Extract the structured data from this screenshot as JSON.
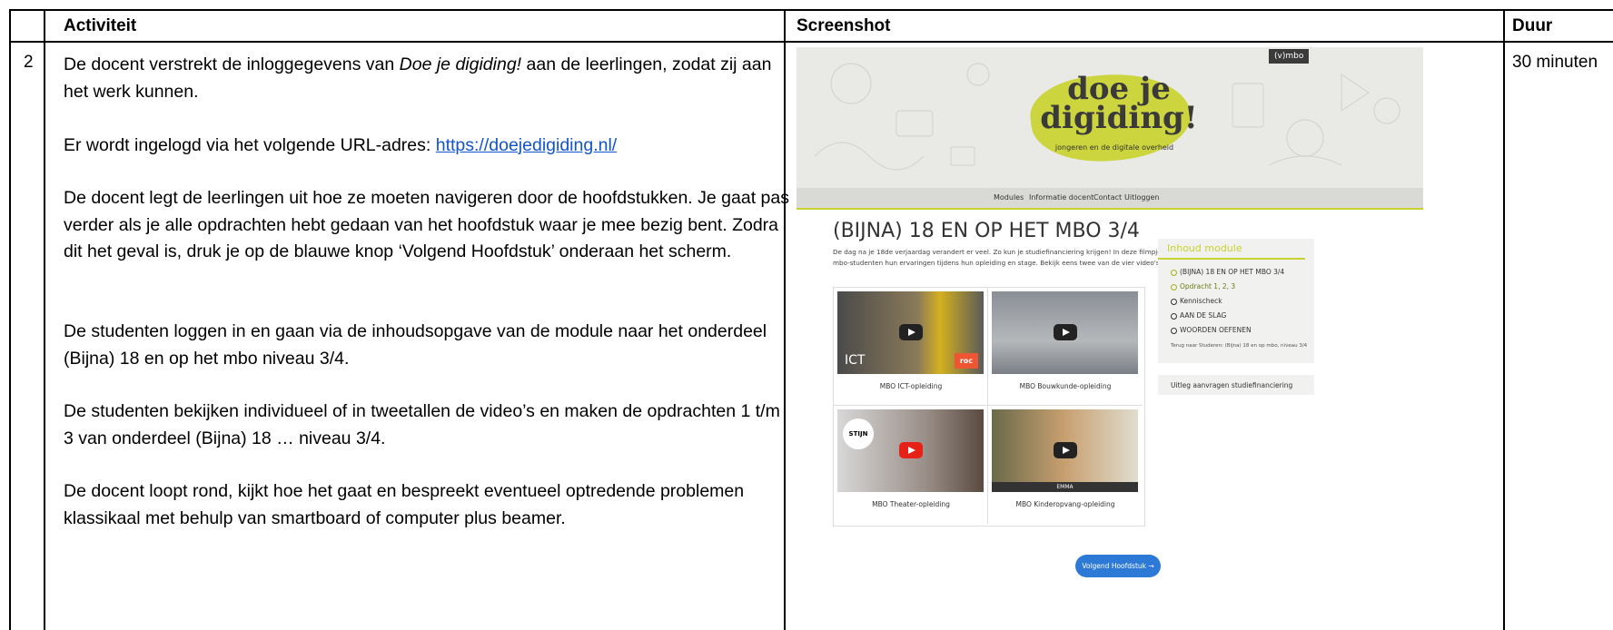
{
  "table": {
    "headers": {
      "activiteit": "Activiteit",
      "screenshot": "Screenshot",
      "duur": "Duur"
    },
    "row": {
      "number": "2",
      "duur": "30 minuten",
      "paragraphs": {
        "p1_a": "De docent verstrekt de inloggegevens van ",
        "p1_italic": "Doe je digiding!",
        "p1_b": " aan de leerlingen, zodat zij aan het werk kunnen.",
        "p2_text": "Er wordt ingelogd via het volgende URL-adres: ",
        "p2_link": "https://doejedigiding.nl/",
        "p3": "De docent legt de leerlingen uit hoe ze moeten navigeren door de hoofdstukken. Je gaat pas verder als je alle opdrachten hebt gedaan van het hoofdstuk waar je mee bezig bent. Zodra dit het geval is, druk je op de blauwe knop ‘Volgend Hoofdstuk’ onderaan het scherm.",
        "p4": "De studenten loggen in en gaan via de inhoudsopgave van de module naar het onderdeel (Bijna) 18 en op het mbo niveau 3/4.",
        "p5": "De studenten bekijken individueel of in tweetallen de video’s en maken de opdrachten 1 t/m 3 van onderdeel (Bijna) 18 … niveau 3/4.",
        "p6": "De docent loopt rond, kijkt hoe het gaat en bespreekt eventueel optredende problemen klassikaal met behulp van smartboard of computer plus beamer."
      }
    }
  },
  "site": {
    "badge": "(v)mbo",
    "logo_line1": "doe je",
    "logo_line2": "digiding!",
    "logo_sub": "jongeren en de digitale overheid",
    "nav": [
      "Modules",
      "Informatie docent",
      "Contact",
      "Uitloggen"
    ],
    "page_title": "(BIJNA) 18 EN OP HET MBO 3/4",
    "page_desc": "De dag na je 18de verjaardag verandert er veel. Zo kun je studiefinanciering krijgen! In deze filmpjes delen mbo-studenten hun ervaringen tijdens hun opleiding en stage. Bekijk eens twee van de vier video's:",
    "videos": [
      {
        "caption": "MBO ICT-opleiding",
        "overlay": "ICT",
        "logo": "roc"
      },
      {
        "caption": "MBO Bouwkunde-opleiding"
      },
      {
        "caption": "MBO Theater-opleiding",
        "overlay": "STIJN"
      },
      {
        "caption": "MBO Kinderopvang-opleiding",
        "overlay": "EMMA"
      }
    ],
    "sidebar": {
      "heading": "Inhoud module",
      "items": [
        "(BIJNA) 18 EN OP HET MBO 3/4",
        "Opdracht 1, 2, 3",
        "Kennischeck",
        "AAN DE SLAG",
        "WOORDEN OEFENEN"
      ],
      "back": "Terug naar Studeren: (Bijna) 18 en op mbo, niveau 3/4",
      "extra": "Uitleg aanvragen studiefinanciering"
    },
    "next_button": "Volgend Hoofdstuk →",
    "colors": {
      "accent": "#c8d22c",
      "button": "#2c7ad6",
      "link": "#1155cc"
    }
  }
}
